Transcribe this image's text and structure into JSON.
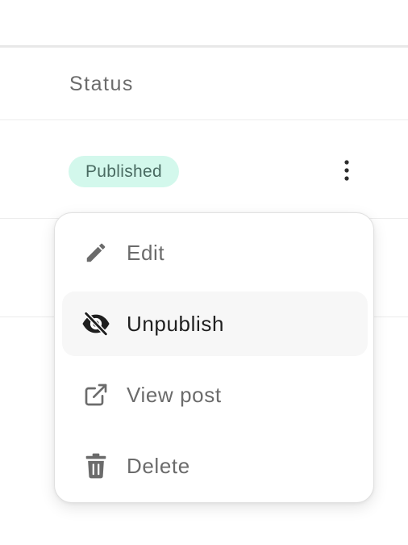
{
  "table": {
    "status_header": "Status",
    "rows": [
      {
        "status": "Published"
      }
    ]
  },
  "row_actions": {
    "kebab_icon": "more-vertical-icon"
  },
  "menu": {
    "items": [
      {
        "label": "Edit",
        "icon": "pencil-icon"
      },
      {
        "label": "Unpublish",
        "icon": "eye-off-icon",
        "active": true
      },
      {
        "label": "View post",
        "icon": "external-link-icon"
      },
      {
        "label": "Delete",
        "icon": "trash-icon"
      }
    ]
  },
  "colors": {
    "badge_bg": "#d3f8ec",
    "badge_text": "#4a6b62",
    "muted_text": "#6b6b6b",
    "active_text": "#1f1f1f",
    "active_item_bg": "#f7f7f7"
  }
}
